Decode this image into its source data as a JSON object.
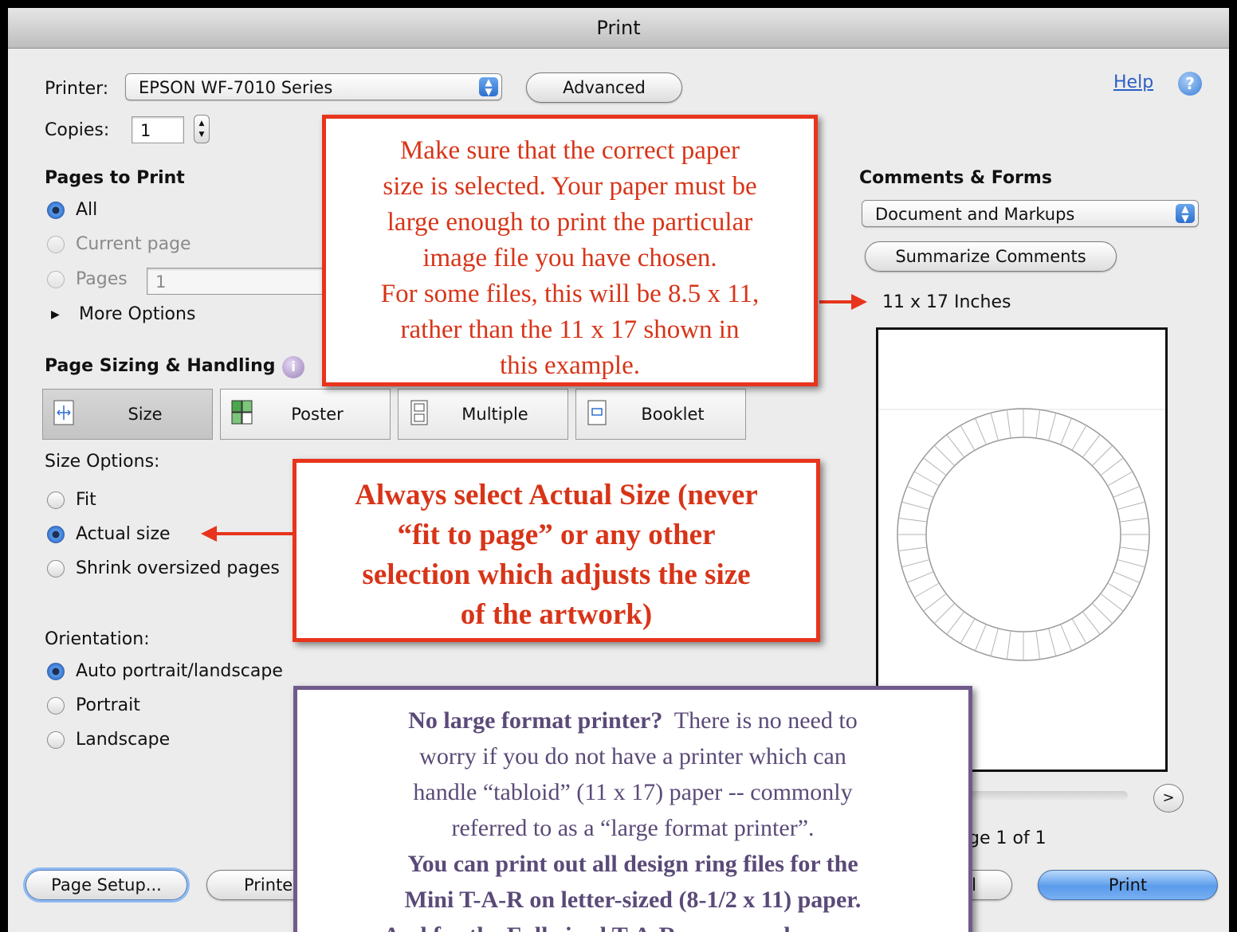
{
  "window": {
    "title": "Print"
  },
  "printer": {
    "label": "Printer:",
    "value": "EPSON WF-7010 Series",
    "advanced_label": "Advanced"
  },
  "help": {
    "label": "Help"
  },
  "copies": {
    "label": "Copies:",
    "value": "1"
  },
  "pages_to_print": {
    "heading": "Pages to Print",
    "all": "All",
    "current_page": "Current page",
    "pages": "Pages",
    "pages_value": "1",
    "more_options": "More Options",
    "selected": "All"
  },
  "page_sizing": {
    "heading": "Page Sizing & Handling",
    "tabs": [
      "Size",
      "Poster",
      "Multiple",
      "Booklet"
    ],
    "selected_tab": "Size",
    "size_options_label": "Size Options:",
    "fit": "Fit",
    "actual_size": "Actual size",
    "shrink": "Shrink oversized pages",
    "selected_option": "Actual size"
  },
  "orientation": {
    "label": "Orientation:",
    "auto": "Auto portrait/landscape",
    "portrait": "Portrait",
    "landscape": "Landscape",
    "selected": "Auto portrait/landscape"
  },
  "comments_forms": {
    "heading": "Comments & Forms",
    "value": "Document and Markups",
    "summarize_label": "Summarize Comments"
  },
  "preview": {
    "paper_size": "11 x 17 Inches",
    "page_indicator": "ge 1 of 1",
    "next_label": ">"
  },
  "bottom_buttons": {
    "page_setup": "Page Setup...",
    "printer_partial": "Printe",
    "cancel_partial": "l",
    "print": "Print"
  },
  "callouts": {
    "paper_size_note": [
      "Make sure that the correct paper",
      "size is selected.  Your paper must be",
      "large enough to print the particular",
      "image file you have chosen.",
      "For some files, this will be 8.5 x 11,",
      "rather than the 11 x 17 shown in",
      "this example."
    ],
    "actual_size_note": [
      "Always select Actual Size (never",
      "“fit to page” or any other",
      "selection which adjusts the size",
      "of the artwork)"
    ],
    "large_format_note": {
      "line1_bold": "No large format printer?",
      "line1_rest": "  There is no need to",
      "line2": "worry if you do not have a printer which can",
      "line3": "handle “tabloid” (11 x 17) paper -- commonly",
      "line4": "referred to as a “large format printer”.",
      "line5": "You can print out all design ring files for the",
      "line6": "Mini T-A-R on letter-sized (8-1/2 x 11) paper.",
      "line7": "And for the Full-sized T-A-R, you can choose our"
    }
  },
  "colors": {
    "callout_red": "#e8341c",
    "callout_purple": "#6f5a8c",
    "accent_blue": "#3b7fd9"
  }
}
